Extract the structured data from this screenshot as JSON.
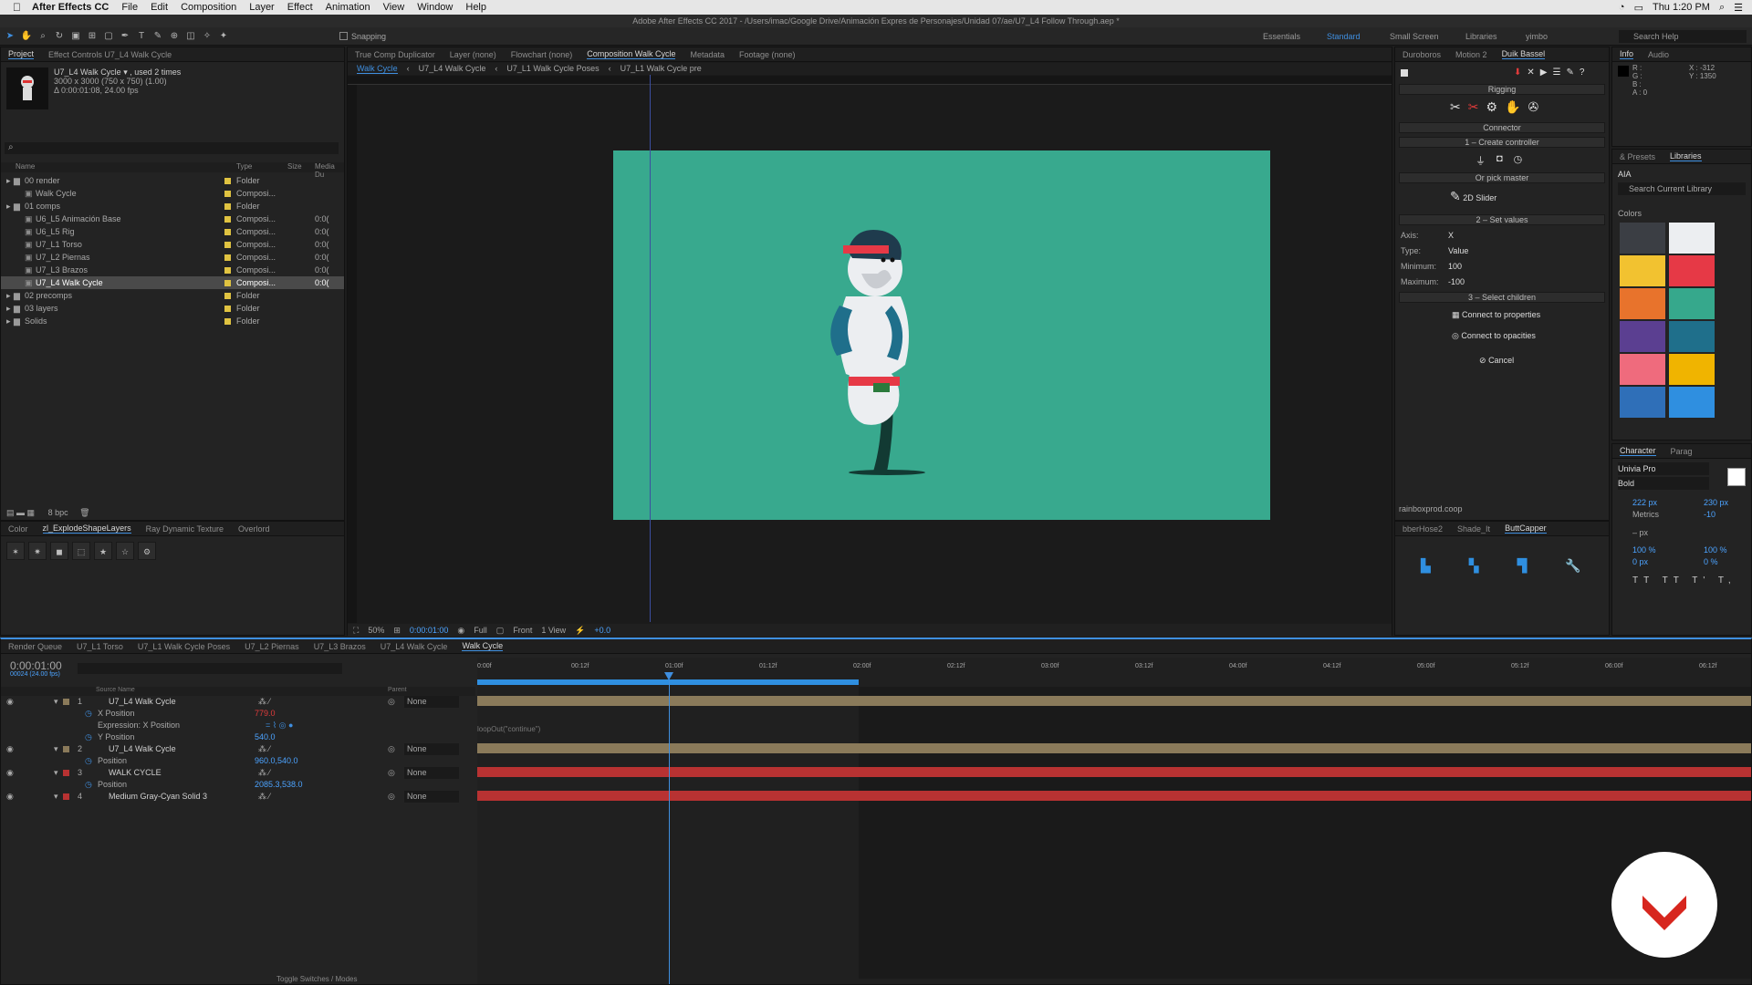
{
  "menubar": {
    "app": "After Effects CC",
    "items": [
      "File",
      "Edit",
      "Composition",
      "Layer",
      "Effect",
      "Animation",
      "View",
      "Window",
      "Help"
    ],
    "clock": "Thu 1:20 PM"
  },
  "window": {
    "title": "Adobe After Effects CC 2017 - /Users/imac/Google Drive/Animación Expres de Personajes/Unidad 07/ae/U7_L4 Follow Through.aep *"
  },
  "toolbar": {
    "snapping": "Snapping"
  },
  "workspaces": {
    "essentials": "Essentials",
    "standard": "Standard",
    "small_screen": "Small Screen",
    "libraries": "Libraries",
    "yimbo": "yimbo",
    "search": "Search Help"
  },
  "project": {
    "tab_project": "Project",
    "tab_effect": "Effect Controls U7_L4 Walk Cycle",
    "comp_name": "U7_L4 Walk Cycle ▾ , used 2 times",
    "comp_dims": "3000 x 3000 (750 x 750) (1.00)",
    "comp_dur": "Δ 0:00:01:08, 24.00 fps",
    "col_name": "Name",
    "col_type": "Type",
    "col_size": "Size",
    "col_media": "Media Du",
    "items": [
      {
        "name": "00 render",
        "type": "Folder",
        "size": "",
        "kind": "folder",
        "indent": 0,
        "color": "#e0c341"
      },
      {
        "name": "Walk Cycle",
        "type": "Composi...",
        "size": "",
        "kind": "comp",
        "indent": 1,
        "color": "#e0c341"
      },
      {
        "name": "01 comps",
        "type": "Folder",
        "size": "",
        "kind": "folder",
        "indent": 0,
        "color": "#e0c341"
      },
      {
        "name": "U6_L5 Animación Base",
        "type": "Composi...",
        "size": "0:0(",
        "kind": "comp",
        "indent": 1,
        "color": "#e0c341"
      },
      {
        "name": "U6_L5 Rig",
        "type": "Composi...",
        "size": "0:0(",
        "kind": "comp",
        "indent": 1,
        "color": "#e0c341"
      },
      {
        "name": "U7_L1 Torso",
        "type": "Composi...",
        "size": "0:0(",
        "kind": "comp",
        "indent": 1,
        "color": "#e0c341"
      },
      {
        "name": "U7_L2 Piernas",
        "type": "Composi...",
        "size": "0:0(",
        "kind": "comp",
        "indent": 1,
        "color": "#e0c341"
      },
      {
        "name": "U7_L3 Brazos",
        "type": "Composi...",
        "size": "0:0(",
        "kind": "comp",
        "indent": 1,
        "color": "#e0c341"
      },
      {
        "name": "U7_L4 Walk Cycle",
        "type": "Composi...",
        "size": "0:0(",
        "kind": "comp",
        "indent": 1,
        "color": "#e0c341",
        "selected": true
      },
      {
        "name": "02 precomps",
        "type": "Folder",
        "size": "",
        "kind": "folder",
        "indent": 0,
        "color": "#e0c341"
      },
      {
        "name": "03 layers",
        "type": "Folder",
        "size": "",
        "kind": "folder",
        "indent": 0,
        "color": "#e0c341"
      },
      {
        "name": "Solids",
        "type": "Folder",
        "size": "",
        "kind": "folder",
        "indent": 0,
        "color": "#e0c341"
      }
    ],
    "bpc": "8 bpc"
  },
  "effects_tabs": [
    "Color",
    "zl_ExplodeShapeLayers",
    "Ray Dynamic Texture",
    "Overlord"
  ],
  "comp": {
    "tabs": [
      "True Comp Duplicator",
      "Layer (none)",
      "Flowchart (none)",
      "Composition Walk Cycle",
      "Metadata",
      "Footage (none)"
    ],
    "breadcrumbs": [
      "Walk Cycle",
      "U7_L4 Walk Cycle",
      "U7_L1 Walk Cycle Poses",
      "U7_L1 Walk Cycle pre"
    ],
    "zoom": "50%",
    "time": "0:00:01:00",
    "resolution": "Full",
    "view": "Front",
    "views": "1 View",
    "exposure": "+0.0",
    "bg_color": "#38a98e"
  },
  "duik": {
    "tabs": [
      "Duroboros",
      "Motion 2",
      "Duik Bassel"
    ],
    "section": "Rigging",
    "connector": "Connector",
    "create_ctrl": "1 – Create controller",
    "or_pick": "Or pick master",
    "slider": "2D Slider",
    "set_values": "2 – Set values",
    "axis_label": "Axis:",
    "axis_value": "X",
    "type_label": "Type:",
    "type_value": "Value",
    "min_label": "Minimum:",
    "min_value": "100",
    "max_label": "Maximum:",
    "max_value": "-100",
    "select_children": "3 – Select children",
    "connect_props": "Connect to properties",
    "connect_opac": "Connect to opacities",
    "cancel": "Cancel",
    "site": "rainboxprod.coop",
    "bottom_tabs": [
      "bberHose2",
      "Shade_It",
      "ButtCapper"
    ]
  },
  "info": {
    "tabs": [
      "Info",
      "Audio"
    ],
    "r": "R :",
    "g": "G :",
    "b": "B :",
    "a": "A : 0",
    "x": "X : -312",
    "y": "Y : 1350"
  },
  "libraries": {
    "tabs": [
      "& Presets",
      "Libraries"
    ],
    "lib": "AIA",
    "search": "Search Current Library",
    "colors_label": "Colors",
    "colors": [
      "#3b3e44",
      "#eceef1",
      "#f2c230",
      "#e63946",
      "#e8732c",
      "#36a88c",
      "#5b3f91",
      "#1f6f8b",
      "#ef6b7d",
      "#f0b400",
      "#2f6fb8",
      "#2f8fe0"
    ]
  },
  "character": {
    "tabs": [
      "Character",
      "Parag"
    ],
    "font": "Univia Pro",
    "style": "Bold",
    "size": "222 px",
    "leading": "230 px",
    "metrics": "Metrics",
    "tracking": "-10",
    "px": "– px",
    "vscale": "100 %",
    "hscale": "100 %",
    "baseline": "0 px",
    "tsume": "0 %"
  },
  "timeline": {
    "tabs": [
      "Render Queue",
      "U7_L1 Torso",
      "U7_L1 Walk Cycle Poses",
      "U7_L2 Piernas",
      "U7_L3 Brazos",
      "U7_L4 Walk Cycle",
      "Walk Cycle"
    ],
    "timecode": "0:00:01:00",
    "frames": "00024 (24.00 fps)",
    "col_source": "Source Name",
    "col_parent": "Parent",
    "ruler": [
      "0:00f",
      "00:12f",
      "01:00f",
      "01:12f",
      "02:00f",
      "02:12f",
      "03:00f",
      "03:12f",
      "04:00f",
      "04:12f",
      "05:00f",
      "05:12f",
      "06:00f",
      "06:12f"
    ],
    "layers": [
      {
        "num": "1",
        "name": "U7_L4 Walk Cycle",
        "parent": "None",
        "color": "#8a7a5a",
        "kind": "layer"
      },
      {
        "num": "",
        "name": "X Position",
        "value": "779.0",
        "kind": "prop",
        "valclass": "red"
      },
      {
        "num": "",
        "name": "Expression: X Position",
        "value": "",
        "kind": "expr"
      },
      {
        "num": "",
        "name": "Y Position",
        "value": "540.0",
        "kind": "prop",
        "valclass": "blue"
      },
      {
        "num": "2",
        "name": "U7_L4 Walk Cycle",
        "parent": "None",
        "color": "#8a7a5a",
        "kind": "layer"
      },
      {
        "num": "",
        "name": "Position",
        "value": "960.0,540.0",
        "kind": "prop",
        "valclass": "blue"
      },
      {
        "num": "3",
        "name": "WALK CYCLE",
        "parent": "None",
        "color": "#b83232",
        "kind": "layer"
      },
      {
        "num": "",
        "name": "Position",
        "value": "2085.3,538.0",
        "kind": "prop",
        "valclass": "blue"
      },
      {
        "num": "4",
        "name": "Medium Gray-Cyan Solid 3",
        "parent": "None",
        "color": "#b83232",
        "kind": "layer"
      }
    ],
    "expression": "loopOut(\"continue\")",
    "toggle": "Toggle Switches / Modes"
  }
}
